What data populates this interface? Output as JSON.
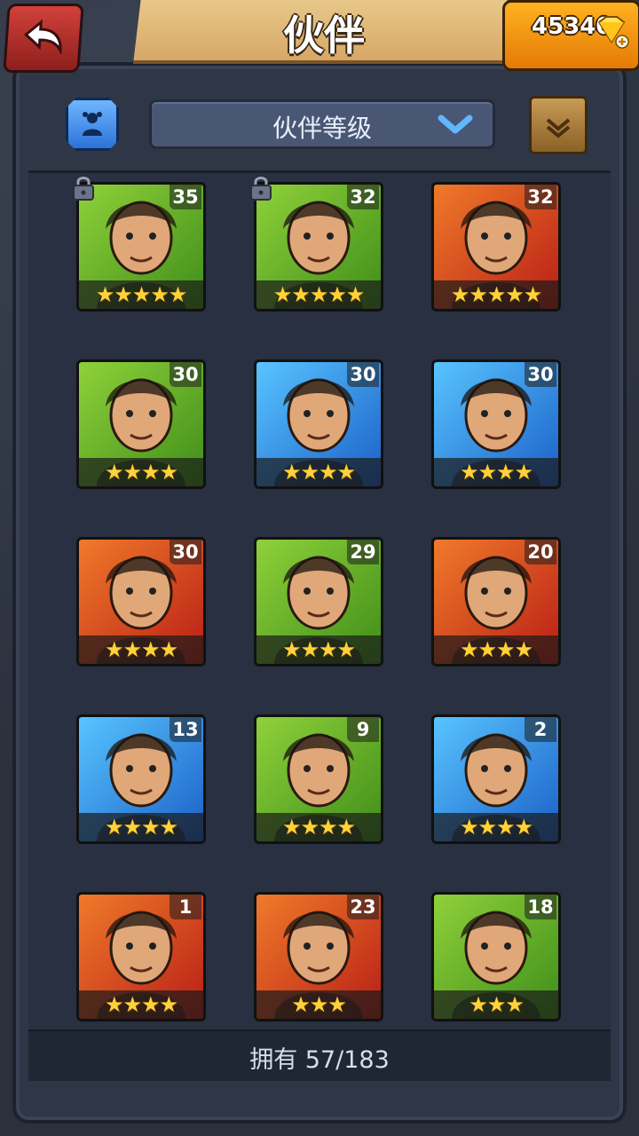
{
  "header": {
    "title": "伙伴",
    "gems": "45340"
  },
  "toolbar": {
    "sort_label": "伙伴等级"
  },
  "companions": [
    {
      "level": "35",
      "stars": "★★★★★",
      "color": "green",
      "locked": true,
      "icon": "elephant-warrior"
    },
    {
      "level": "32",
      "stars": "★★★★★",
      "color": "green",
      "locked": true,
      "icon": "rabbit-hood-woman"
    },
    {
      "level": "32",
      "stars": "★★★★★",
      "color": "red",
      "locked": false,
      "icon": "brown-hair-woman"
    },
    {
      "level": "30",
      "stars": "★★★★",
      "color": "green",
      "locked": false,
      "icon": "ponytail-woman"
    },
    {
      "level": "30",
      "stars": "★★★★",
      "color": "blue",
      "locked": false,
      "icon": "hooded-mage"
    },
    {
      "level": "30",
      "stars": "★★★★",
      "color": "blue",
      "locked": false,
      "icon": "bearded-warrior"
    },
    {
      "level": "30",
      "stars": "★★★★",
      "color": "red",
      "locked": false,
      "icon": "long-hair-man"
    },
    {
      "level": "29",
      "stars": "★★★★",
      "color": "green",
      "locked": false,
      "icon": "crocodile"
    },
    {
      "level": "20",
      "stars": "★★★★",
      "color": "red",
      "locked": false,
      "icon": "scarecrow"
    },
    {
      "level": "13",
      "stars": "★★★★",
      "color": "blue",
      "locked": false,
      "icon": "dark-hair-woman"
    },
    {
      "level": "9",
      "stars": "★★★★",
      "color": "green",
      "locked": false,
      "icon": "armored-croc"
    },
    {
      "level": "2",
      "stars": "★★★★",
      "color": "blue",
      "locked": false,
      "icon": "swordsman"
    },
    {
      "level": "1",
      "stars": "★★★★",
      "color": "red",
      "locked": false,
      "icon": "red-dragon"
    },
    {
      "level": "23",
      "stars": "★★★",
      "color": "red",
      "locked": false,
      "icon": "red-hair-brute"
    },
    {
      "level": "18",
      "stars": "★★★",
      "color": "green",
      "locked": false,
      "icon": "boar-orc"
    }
  ],
  "footer": {
    "owned_text": "拥有 57/183"
  }
}
